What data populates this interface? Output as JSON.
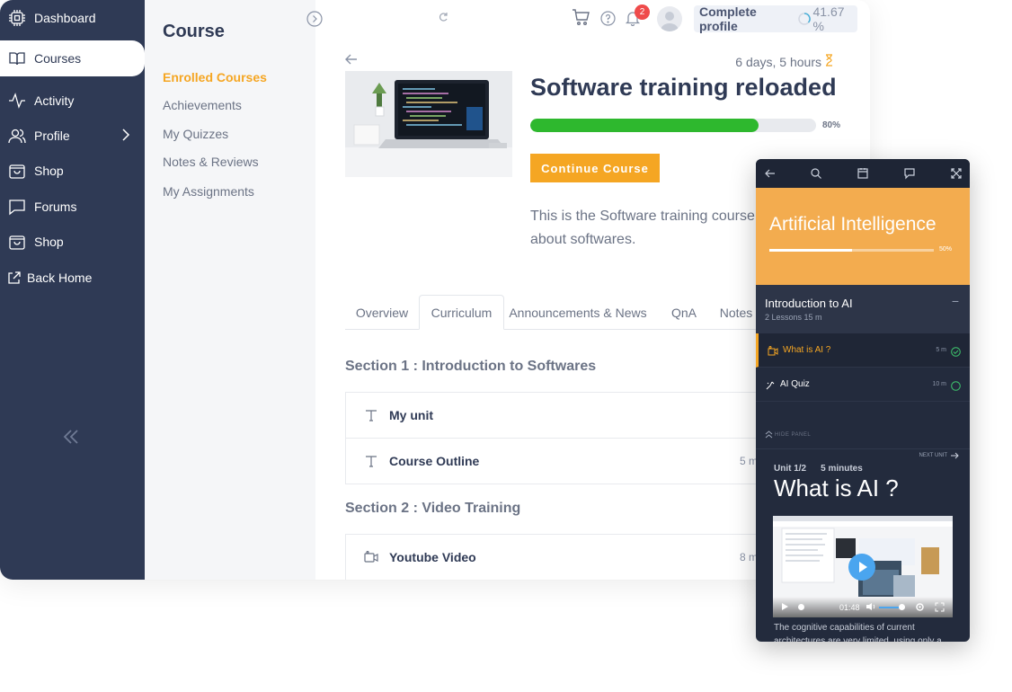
{
  "sidebar": {
    "items": [
      {
        "label": "Dashboard",
        "icon": "chip-icon"
      },
      {
        "label": "Courses",
        "icon": "book-icon"
      },
      {
        "label": "Activity",
        "icon": "activity-icon"
      },
      {
        "label": "Profile",
        "icon": "users-icon"
      },
      {
        "label": "Shop",
        "icon": "bag-icon"
      },
      {
        "label": "Forums",
        "icon": "chat-icon"
      },
      {
        "label": "Shop",
        "icon": "bag-icon"
      },
      {
        "label": "Back Home",
        "icon": "external-link-icon"
      }
    ],
    "active_index": 1
  },
  "submenu": {
    "title": "Course",
    "items": [
      {
        "label": "Enrolled Courses",
        "active": true
      },
      {
        "label": "Achievements",
        "active": false
      },
      {
        "label": "My Quizzes",
        "active": false
      },
      {
        "label": "Notes & Reviews",
        "active": false
      },
      {
        "label": "My Assignments",
        "active": false
      }
    ]
  },
  "topbar": {
    "notification_count": "2",
    "profile_label": "Complete profile",
    "profile_percent": "41.67 %"
  },
  "course": {
    "time_left": "6 days, 5 hours",
    "title": "Software training reloaded",
    "progress": 0.8,
    "progress_label": "80%",
    "continue_label": "Continue Course",
    "description": "This is the Software training course about softwares."
  },
  "tabs": [
    "Overview",
    "Curriculum",
    "Announcements & News",
    "QnA",
    "Notes"
  ],
  "active_tab": 1,
  "sections": [
    {
      "title": "Section 1 : Introduction to Softwares",
      "units": [
        {
          "name": "My unit",
          "duration": "",
          "icon": "text-icon"
        },
        {
          "name": "Course Outline",
          "duration": "5 m",
          "icon": "text-icon"
        }
      ]
    },
    {
      "title": "Section 2 : Video Training",
      "units": [
        {
          "name": "Youtube Video",
          "duration": "8 m",
          "icon": "video-icon"
        }
      ]
    }
  ],
  "mobile": {
    "course_title": "Artificial Intelligence",
    "progress": 0.5,
    "progress_label": "50%",
    "section_title": "Introduction to AI",
    "section_meta": "2 Lessons  15 m",
    "lessons": [
      {
        "name": "What is AI ?",
        "duration": "5 m",
        "active": true,
        "done": true
      },
      {
        "name": "AI Quiz",
        "duration": "10 m",
        "active": false,
        "done": false
      }
    ],
    "hide_panel": "HIDE PANEL",
    "next_unit": "NEXT UNIT",
    "unit_index": "Unit 1/2",
    "unit_duration": "5 minutes",
    "unit_title": "What is AI ?",
    "video_time": "01:48",
    "description": "The cognitive capabilities of current architectures are very limited, using only a"
  },
  "colors": {
    "sidebar": "#2f3a55",
    "accent": "#f5a623",
    "progress": "#2eb82e",
    "badge": "#ef4b4b",
    "mobile_bg": "#232b3d",
    "mobile_hero": "#f3ac4f"
  }
}
